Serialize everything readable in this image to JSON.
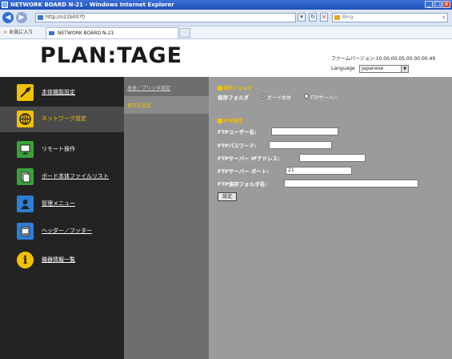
{
  "browser": {
    "title": "NETWORK BOARD N-21 - Windows Internet Explorer",
    "address": "http://n21b007f/",
    "search_placeholder": "Bing",
    "favorites_label": "お気に入り",
    "tab_label": "NETWORK BOARD N-21"
  },
  "header": {
    "logo": "PLAN:TAGE",
    "firmware": "ファームバージョン:10.00.00.05.00.00.00.49",
    "language_label": "Language",
    "language_value": "Japanese"
  },
  "sidebar": {
    "items": [
      {
        "label": "本体機能設定",
        "icon": "wrench-icon",
        "active": false
      },
      {
        "label": "ネットワーク設定",
        "icon": "network-globe-icon",
        "active": true
      },
      {
        "label": "リモート操作",
        "icon": "remote-display-icon",
        "active": false
      },
      {
        "label": "ボード本体ファイルリスト",
        "icon": "file-list-icon",
        "active": false
      },
      {
        "label": "管理メニュー",
        "icon": "user-admin-icon",
        "active": false
      },
      {
        "label": "ヘッダー／フッター",
        "icon": "header-footer-icon",
        "active": false
      },
      {
        "label": "機器情報一覧",
        "icon": "info-icon",
        "active": false
      }
    ]
  },
  "submenu": {
    "items": [
      {
        "label": "本体／プリンタ設定",
        "active": false
      },
      {
        "label": "保存先設定",
        "active": true
      }
    ]
  },
  "main": {
    "save_folder_section": "保存フォルダ",
    "save_folder_label": "保存フォルダ",
    "option_board": "ボード本体",
    "option_ftp": "FTPサーバー",
    "ftp_section": "FTP設定",
    "ftp_user_label": "FTPユーザー名:",
    "ftp_user_value": "",
    "ftp_password_label": "FTPパスワード:",
    "ftp_password_value": "",
    "ftp_ip_label": "FTPサーバー IPアドレス:",
    "ftp_ip_value": "",
    "ftp_port_label": "FTPサーバー ポート:",
    "ftp_port_value": "21",
    "ftp_folder_label": "FTP保存フォルダ名:",
    "ftp_folder_value": "",
    "set_button": "設定"
  }
}
